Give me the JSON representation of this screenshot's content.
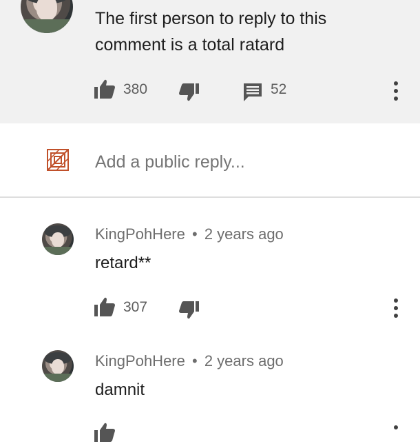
{
  "top_comment": {
    "text": "The first person to reply to this comment is a total ratard",
    "likes": "380",
    "replies_count": "52",
    "icons": {
      "like": "thumbs-up-icon",
      "dislike": "thumbs-down-icon",
      "comment": "comment-icon",
      "more": "more-vert-icon"
    }
  },
  "reply_box": {
    "placeholder": "Add a public reply...",
    "icon": "channel-avatar-icon"
  },
  "replies": [
    {
      "author": "KingPohHere",
      "separator": "•",
      "time": "2 years ago",
      "text": "retard**",
      "likes": "307"
    },
    {
      "author": "KingPohHere",
      "separator": "•",
      "time": "2 years ago",
      "text": "damnit"
    }
  ],
  "colors": {
    "top_bg": "#f1f1f1",
    "reply_icon": "#c0502a",
    "icon_gray": "#555555"
  }
}
